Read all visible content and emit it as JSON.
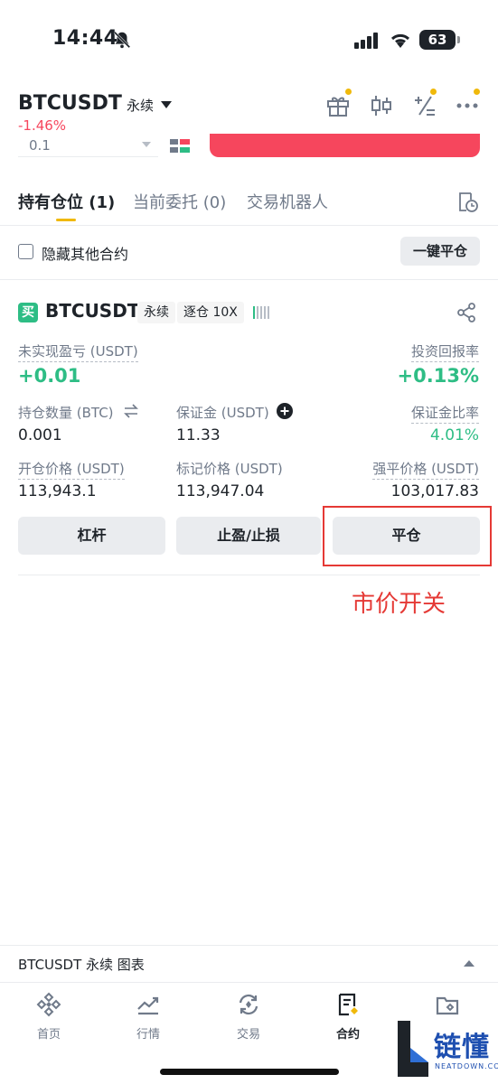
{
  "status_bar": {
    "time": "14:44",
    "battery": "63"
  },
  "header": {
    "symbol": "BTCUSDT",
    "contract_type": "永续",
    "price_change": "-1.46%",
    "accent": "#f0b90b"
  },
  "order_form": {
    "quantity": "0.1"
  },
  "tabs": [
    {
      "label": "持有仓位 (1)",
      "active": true
    },
    {
      "label": "当前委托 (0)",
      "active": false
    },
    {
      "label": "交易机器人",
      "active": false
    }
  ],
  "hide_others": {
    "label": "隐藏其他合约",
    "checked": false
  },
  "close_all_label": "一键平仓",
  "position": {
    "side_badge": "买",
    "symbol": "BTCUSDT",
    "contract_type": "永续",
    "margin_mode": "逐仓 10X",
    "unrealized_pnl_label": "未实现盈亏 (USDT)",
    "unrealized_pnl": "+0.01",
    "roi_label": "投资回报率",
    "roi": "+0.13%",
    "size_label": "持仓数量 (BTC)",
    "size": "0.001",
    "margin_label": "保证金 (USDT)",
    "margin": "11.33",
    "margin_ratio_label": "保证金比率",
    "margin_ratio": "4.01%",
    "entry_price_label": "开仓价格 (USDT)",
    "entry_price": "113,943.1",
    "mark_price_label": "标记价格 (USDT)",
    "mark_price": "113,947.04",
    "liq_price_label": "强平价格 (USDT)",
    "liq_price": "103,017.83"
  },
  "actions": {
    "leverage": "杠杆",
    "tp_sl": "止盈/止损",
    "close": "平仓"
  },
  "annotation": "市价开关",
  "chart_bar": {
    "label": "BTCUSDT 永续  图表"
  },
  "nav": [
    {
      "label": "首页",
      "icon": "home-icon",
      "active": false
    },
    {
      "label": "行情",
      "icon": "markets-icon",
      "active": false
    },
    {
      "label": "交易",
      "icon": "trade-icon",
      "active": false
    },
    {
      "label": "合约",
      "icon": "futures-icon",
      "active": true
    },
    {
      "label": "资产",
      "icon": "wallet-icon",
      "active": false
    }
  ],
  "watermark": {
    "text": "链懂",
    "sub": "NEATDOWN.COM"
  },
  "colors": {
    "green": "#2ebd85",
    "red": "#f6465d",
    "annotation": "#e53935"
  }
}
